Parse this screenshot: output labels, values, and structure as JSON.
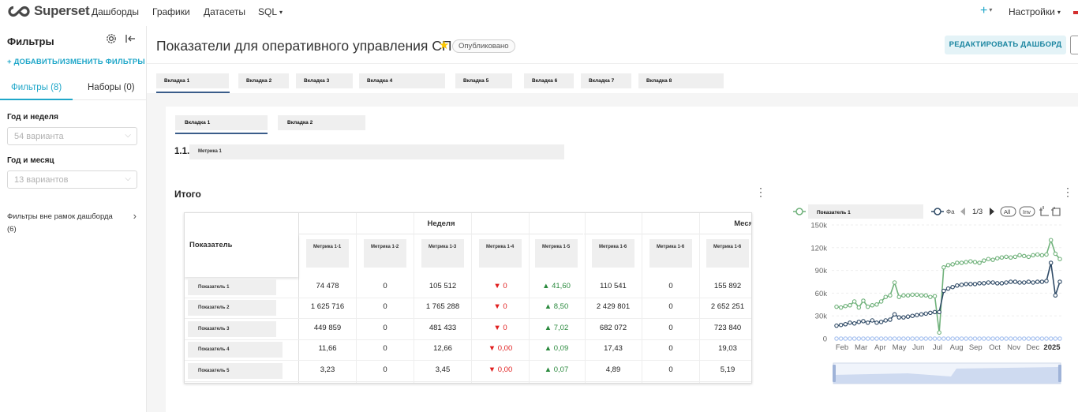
{
  "nav": {
    "logo": "Superset",
    "items": [
      "Дашборды",
      "Графики",
      "Датасеты",
      "SQL"
    ],
    "plus": "+",
    "settings": "Настройки"
  },
  "sidebar": {
    "title": "Фильтры",
    "add_filters": "+ ДОБАВИТЬ/ИЗМЕНИТЬ ФИЛЬТРЫ",
    "tabs": [
      "Фильтры (8)",
      "Наборы (0)"
    ],
    "filters": [
      {
        "label": "Год и неделя",
        "placeholder": "54 варианта"
      },
      {
        "label": "Год и месяц",
        "placeholder": "13 вариантов"
      }
    ],
    "out_of_scope": "Фильтры вне рамок дашборда",
    "out_of_scope_count": "(6)"
  },
  "header": {
    "title": "Показатели для оперативного управления СП",
    "status": "Опубликовано",
    "edit": "РЕДАКТИРОВАТЬ ДАШБОРД"
  },
  "tabs": [
    "Вкладка 1",
    "Вкладка 2",
    "Вкладка 3",
    "Вкладка 4",
    "Вкладка 5",
    "Вкладка 6",
    "Вкладка 7",
    "Вкладка 8"
  ],
  "subtabs": [
    "Вкладка 1",
    "Вкладка 2"
  ],
  "metric": {
    "num": "1.1.",
    "label": "Метрика 1"
  },
  "table": {
    "title": "Итого",
    "group_week": "Неделя",
    "group_month": "Месяц",
    "first_col": "Показатель",
    "col_headers": [
      "Метрика 1-1",
      "Метрика 1-2",
      "Метрика 1-3",
      "Метрика 1-4",
      "Метрика 1-5",
      "Метрика 1-6",
      "Метрика 1-6",
      "Метрика 1-6"
    ],
    "rows": [
      {
        "label": "Показатель 1",
        "cells": [
          "74 478",
          "0",
          "105 512",
          "▼ 0",
          "▲ 41,60",
          "110 541",
          "0",
          "155 892"
        ]
      },
      {
        "label": "Показатель 2",
        "cells": [
          "1 625 716",
          "0",
          "1 765 288",
          "▼ 0",
          "▲ 8,50",
          "2 429 801",
          "0",
          "2 652 251"
        ]
      },
      {
        "label": "Показатель 3",
        "cells": [
          "449 859",
          "0",
          "481 433",
          "▼ 0",
          "▲ 7,02",
          "682 072",
          "0",
          "723 840"
        ]
      },
      {
        "label": "Показатель 4",
        "cells": [
          "11,66",
          "0",
          "12,66",
          "▼ 0,00",
          "▲ 0,09",
          "17,43",
          "0",
          "19,03"
        ]
      },
      {
        "label": "Показатель 5",
        "cells": [
          "3,23",
          "0",
          "3,45",
          "▼ 0,00",
          "▲ 0,07",
          "4,89",
          "0",
          "5,19"
        ]
      }
    ]
  },
  "chart_legend": {
    "series1": "Показатель 1",
    "series2_short": "Фа",
    "page": "1/3",
    "all": "All",
    "inv": "Inv"
  },
  "chart_data": {
    "type": "line",
    "y_ticks": [
      "0",
      "30k",
      "60k",
      "90k",
      "120k",
      "150k"
    ],
    "x_ticks": [
      "Feb",
      "Mar",
      "Apr",
      "May",
      "Jun",
      "Jul",
      "Aug",
      "Sep",
      "Oct",
      "Nov",
      "Dec",
      "2025"
    ],
    "ylim": [
      0,
      150000
    ],
    "colors": {
      "green": "#6fb17a",
      "navy": "#2f4a66",
      "light": "#a9c3f0"
    },
    "series": [
      {
        "values": [
          42000,
          41000,
          43000,
          44000,
          49000,
          41000,
          50000,
          42000,
          44000,
          45000,
          49000,
          55000,
          57000,
          74000,
          55000,
          57000,
          57000,
          58000,
          58000,
          57000,
          57000,
          55000,
          56000,
          8000,
          94000,
          97000,
          98000,
          100000,
          100000,
          101000,
          102000,
          101000,
          100000,
          103000,
          105000,
          104000,
          106000,
          107000,
          108000,
          107000,
          108000,
          110000,
          109000,
          108000,
          110000,
          111000,
          110000,
          111000,
          130000,
          112000,
          105000
        ]
      },
      {
        "values": [
          17000,
          18000,
          19000,
          21000,
          20000,
          22000,
          23000,
          21000,
          24000,
          21000,
          22000,
          24000,
          25000,
          32000,
          28000,
          28000,
          29000,
          30000,
          31000,
          32000,
          33000,
          34000,
          35000,
          35000,
          63000,
          66000,
          68000,
          70000,
          71000,
          72000,
          72000,
          72000,
          73000,
          73000,
          74000,
          74000,
          73000,
          73000,
          74000,
          75000,
          75000,
          74000,
          74000,
          75000,
          74000,
          75000,
          75000,
          76000,
          100000,
          57000,
          75000
        ]
      },
      {
        "values": [
          0,
          0,
          0,
          0,
          0,
          0,
          0,
          0,
          0,
          0,
          0,
          0,
          0,
          0,
          0,
          0,
          0,
          0,
          0,
          0,
          0,
          0,
          0,
          0,
          0,
          0,
          0,
          0,
          0,
          0,
          0,
          0,
          0,
          0,
          0,
          0,
          0,
          0,
          0,
          0,
          0,
          0,
          0,
          0,
          0,
          0,
          0,
          0,
          0,
          0,
          0
        ]
      }
    ]
  }
}
